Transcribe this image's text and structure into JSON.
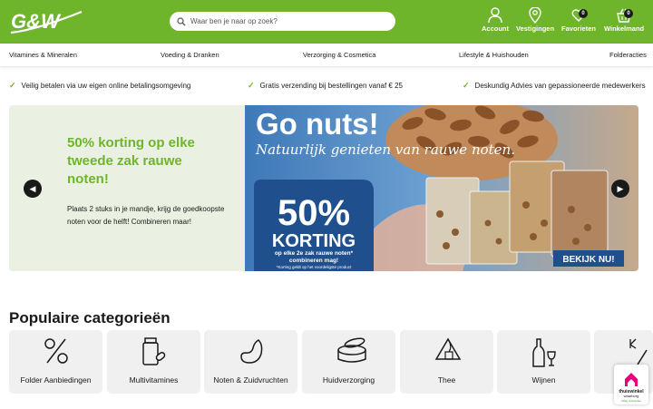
{
  "header": {
    "logo_text": "G&W",
    "search_placeholder": "Waar ben je naar op zoek?",
    "account_label": "Account",
    "stores_label": "Vestigingen",
    "favorites_label": "Favorieten",
    "favorites_count": "0",
    "cart_label": "Winkelmand",
    "cart_count": "0"
  },
  "nav": {
    "items": [
      "Vitamines & Mineralen",
      "Voeding & Dranken",
      "Verzorging & Cosmetica",
      "Lifestyle & Huishouden",
      "Folderacties"
    ]
  },
  "usps": [
    "Veilig betalen via uw eigen online betalingsomgeving",
    "Gratis verzending bij bestellingen vanaf € 25",
    "Deskundig Advies van gepassioneerde medewerkers"
  ],
  "hero": {
    "title": "50% korting op elke tweede zak rauwe noten!",
    "text": "Plaats 2 stuks in je mandje, krijg de goedkoopste noten voor de helft! Combineren maar!",
    "banner_headline": "Go nuts!",
    "banner_subline": "Natuurlijk genieten van rauwe noten.",
    "banner_percent": "50%",
    "banner_korting": "KORTING",
    "banner_offer_line1": "op elke 2e zak rauwe noten*",
    "banner_offer_line2": "combineren mag!",
    "banner_footnote": "*Korting geldt op het voordeligste product",
    "banner_cta": "BEKIJK NU!",
    "prev_icon": "arrow-left-icon",
    "next_icon": "arrow-right-icon"
  },
  "categories": {
    "title": "Populaire categorieën",
    "items": [
      {
        "label": "Folder Aanbiedingen",
        "icon": "percent-icon"
      },
      {
        "label": "Multivitamines",
        "icon": "supplement-bottle-icon"
      },
      {
        "label": "Noten & Zuidvruchten",
        "icon": "cashew-icon"
      },
      {
        "label": "Huidverzorging",
        "icon": "cream-jar-icon"
      },
      {
        "label": "Thee",
        "icon": "tea-bag-icon"
      },
      {
        "label": "Wijnen",
        "icon": "wine-bottle-icon"
      }
    ]
  },
  "seal": {
    "name": "thuiswinkel",
    "sub": "waarborg",
    "verified": "Veilig verbonden"
  },
  "colors": {
    "brand_green": "#6fb52c",
    "dark": "#1a1a1a",
    "hero_left_bg": "#eaf1e2",
    "banner_blue": "#1f4f8c",
    "tile_bg": "#f0f0f0"
  }
}
